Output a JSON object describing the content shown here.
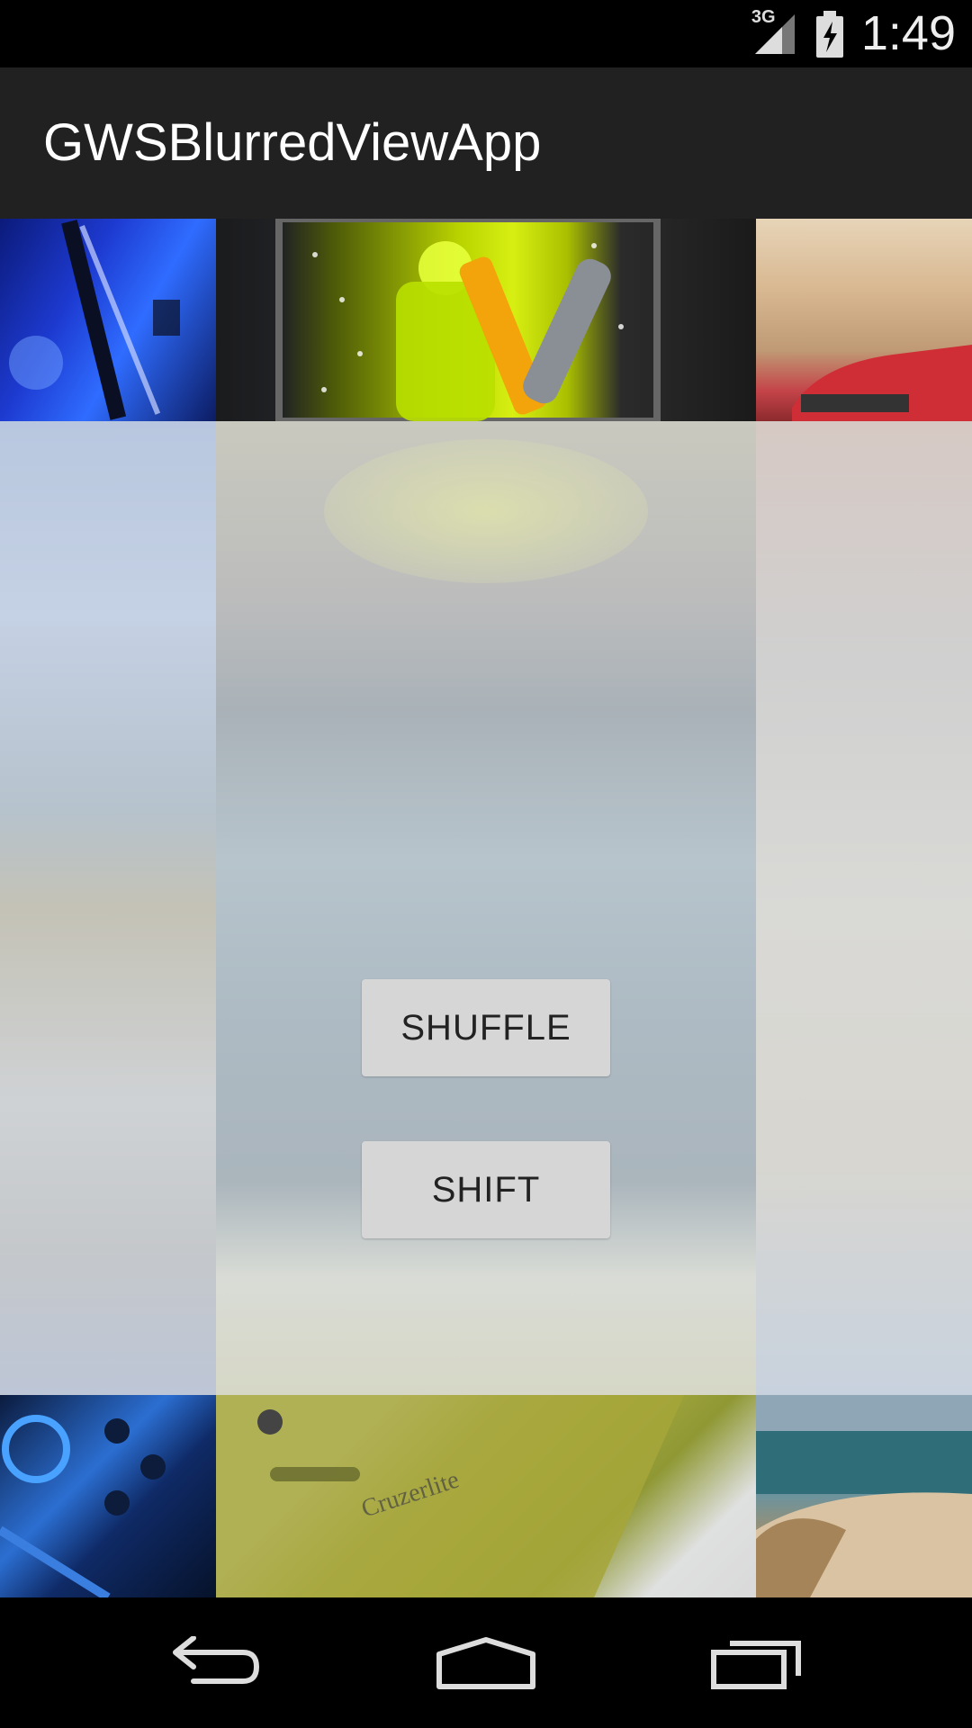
{
  "status_bar": {
    "network": "3G",
    "time": "1:49",
    "icons": [
      "signal-icon",
      "battery-charging-icon"
    ]
  },
  "app_bar": {
    "title": "GWSBlurredViewApp"
  },
  "grid": {
    "top_row": [
      "lab-image",
      "android-tools-image",
      "car-image"
    ],
    "bottom_row": [
      "circuit-image",
      "phone-case-image",
      "beach-image"
    ],
    "phone_case_text": "Cruzerlite"
  },
  "buttons": {
    "shuffle": "SHUFFLE",
    "shift": "SHIFT"
  },
  "nav_bar": {
    "icons": [
      "back-icon",
      "home-icon",
      "recent-apps-icon"
    ]
  }
}
